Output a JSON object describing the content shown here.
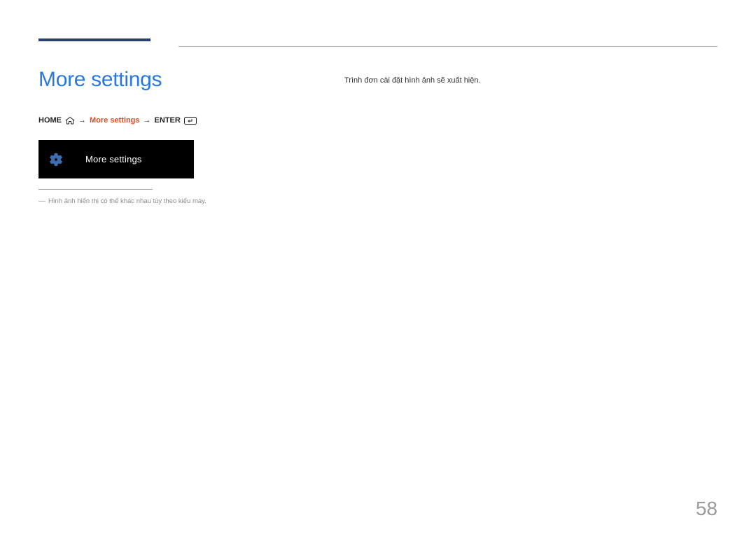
{
  "header": {
    "title": "More settings"
  },
  "breadcrumb": {
    "home": "HOME",
    "step": "More settings",
    "enter": "ENTER",
    "arrow": "→"
  },
  "menu": {
    "label": "More settings"
  },
  "footnote": {
    "dash": "―",
    "text": "Hình ảnh hiển thị có thể khác nhau tùy theo kiểu máy."
  },
  "rightColumn": {
    "description": "Trình đơn cài đặt hình ảnh sẽ xuất hiện."
  },
  "pageNumber": "58"
}
